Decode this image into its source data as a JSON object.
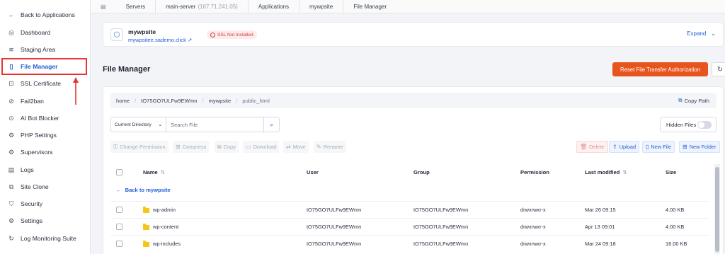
{
  "sidebar": {
    "items": [
      {
        "label": "Back to Applications",
        "icon": "arrow-left-icon",
        "glyph": "←"
      },
      {
        "label": "Dashboard",
        "icon": "dashboard-icon",
        "glyph": "◎"
      },
      {
        "label": "Staging Area",
        "icon": "layers-icon",
        "glyph": "≋"
      },
      {
        "label": "File Manager",
        "icon": "file-icon",
        "glyph": "▯"
      },
      {
        "label": "SSL Certificate",
        "icon": "lock-icon",
        "glyph": "⊡"
      },
      {
        "label": "Fail2ban",
        "icon": "ban-icon",
        "glyph": "⊘"
      },
      {
        "label": "AI Bot Blocker",
        "icon": "bot-icon",
        "glyph": "⊙"
      },
      {
        "label": "PHP Settings",
        "icon": "php-settings-icon",
        "glyph": "⚙"
      },
      {
        "label": "Supervisors",
        "icon": "supervisor-icon",
        "glyph": "⚙"
      },
      {
        "label": "Logs",
        "icon": "logs-icon",
        "glyph": "▤"
      },
      {
        "label": "Site Clone",
        "icon": "clone-icon",
        "glyph": "⧉"
      },
      {
        "label": "Security",
        "icon": "shield-icon",
        "glyph": "⛉"
      },
      {
        "label": "Settings",
        "icon": "gear-icon",
        "glyph": "⚙"
      },
      {
        "label": "Log Monitoring Suite",
        "icon": "monitor-icon",
        "glyph": "↻"
      }
    ],
    "active_index": 3
  },
  "breadcrumb": {
    "servers": "Servers",
    "server_name": "main-server",
    "server_ip": "(167.71.241.05)",
    "applications": "Applications",
    "app_name": "mywpsite",
    "current": "File Manager"
  },
  "site": {
    "name": "mywpsite",
    "url": "mywpsitee.sademo.click ↗",
    "ssl_status": "SSL Not Installed",
    "expand_label": "Expand"
  },
  "page": {
    "title": "File Manager",
    "reset_button": "Reset File Transfer Authorization"
  },
  "path_bar": {
    "segments": [
      "home",
      "tO75GO7ULFw9EWmn",
      "mywpsite",
      "public_html"
    ],
    "copy_label": "Copy Path"
  },
  "search": {
    "scope": "Current Directory",
    "placeholder": "Search File"
  },
  "hidden_files": {
    "label": "Hidden Files",
    "enabled": false
  },
  "toolbar": {
    "change_permission": "Change Permission",
    "compress": "Compress",
    "copy": "Copy",
    "download": "Download",
    "move": "Move",
    "rename": "Rename",
    "delete": "Delete",
    "upload": "Upload",
    "new_file": "New File",
    "new_folder": "New Folder"
  },
  "table": {
    "headers": {
      "name": "Name",
      "user": "User",
      "group": "Group",
      "permission": "Permission",
      "modified": "Last modified",
      "size": "Size"
    },
    "back_label": "Back to mywpsite",
    "rows": [
      {
        "name": "wp-admin",
        "user": "tO75GO7ULFw9EWmn",
        "group": "tO75GO7ULFw9EWmn",
        "permission": "drwxrwxr-x",
        "modified": "Mar 26 09:15",
        "size": "4.00 KB"
      },
      {
        "name": "wp-content",
        "user": "tO75GO7ULFw9EWmn",
        "group": "tO75GO7ULFw9EWmn",
        "permission": "drwxrwxr-x",
        "modified": "Apr 13 09:01",
        "size": "4.00 KB"
      },
      {
        "name": "wp-includes",
        "user": "tO75GO7ULFw9EWmn",
        "group": "tO75GO7ULFw9EWmn",
        "permission": "drwxrwxr-x",
        "modified": "Mar 24 09:18",
        "size": "16.00 KB"
      }
    ]
  },
  "colors": {
    "accent": "#1f5fd6",
    "primary_action": "#e8541e",
    "highlight_outline": "#e53535",
    "folder": "#f5c518"
  }
}
